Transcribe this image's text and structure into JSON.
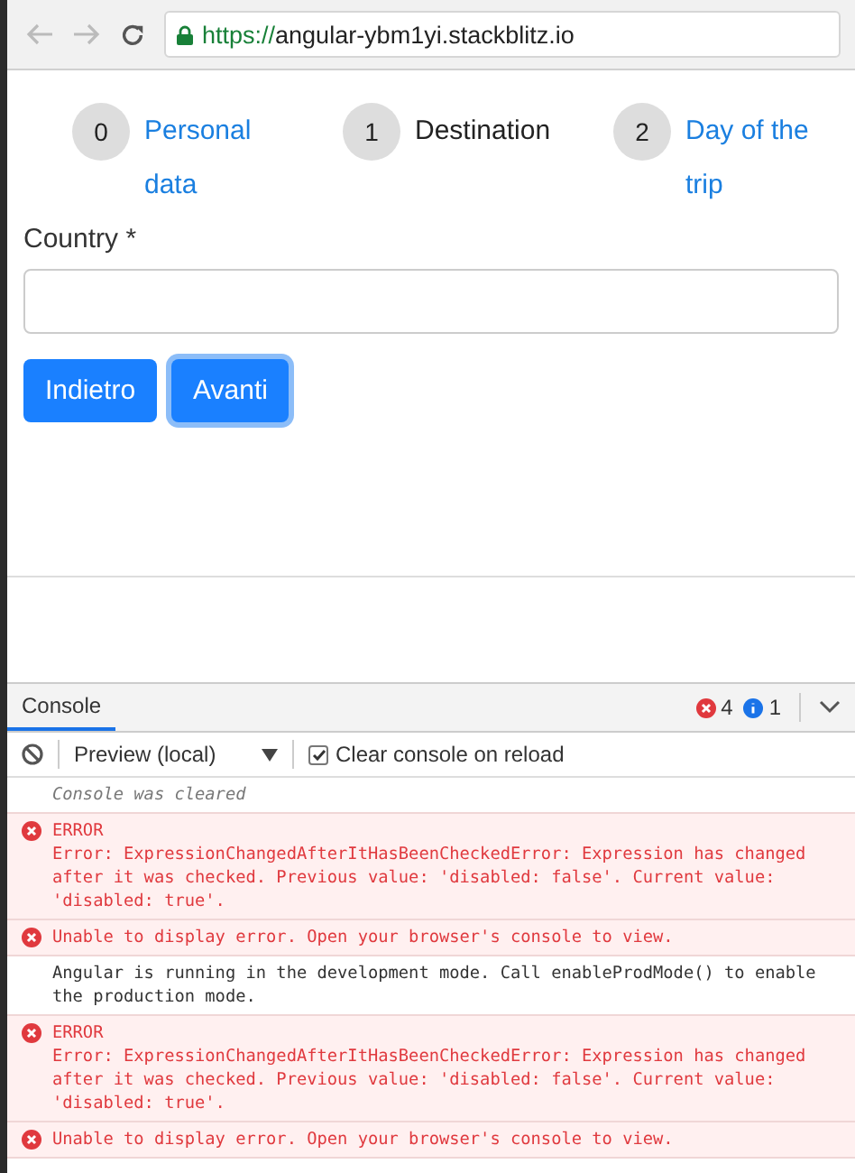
{
  "browser": {
    "url_scheme": "https://",
    "url_host": "angular-ybm1yi.stackblitz.io"
  },
  "steps": [
    {
      "number": "0",
      "label": "Personal data",
      "selected": false
    },
    {
      "number": "1",
      "label": "Destination",
      "selected": true
    },
    {
      "number": "2",
      "label": "Day of the trip",
      "selected": false
    }
  ],
  "form": {
    "label": "Country *"
  },
  "buttons": [
    {
      "label": "Indietro",
      "focused": false
    },
    {
      "label": "Avanti",
      "focused": true
    }
  ],
  "console": {
    "tab": "Console",
    "error_count": "4",
    "info_count": "1",
    "context": "Preview (local)",
    "clear_on_reload": {
      "label": "Clear console on reload",
      "checked": true
    },
    "entries": [
      {
        "kind": "info",
        "text": "Console was cleared"
      },
      {
        "kind": "error",
        "title": "ERROR",
        "text": "Error: ExpressionChangedAfterItHasBeenCheckedError: Expression has changed after it was checked. Previous value: 'disabled: false'. Current value: 'disabled: true'."
      },
      {
        "kind": "error",
        "text": "Unable to display error. Open your browser's console to view."
      },
      {
        "kind": "log",
        "text": "Angular is running in the development mode. Call enableProdMode() to enable the production mode."
      },
      {
        "kind": "error",
        "title": "ERROR",
        "text": "Error: ExpressionChangedAfterItHasBeenCheckedError: Expression has changed after it was checked. Previous value: 'disabled: false'. Current value: 'disabled: true'."
      },
      {
        "kind": "error",
        "text": "Unable to display error. Open your browser's console to view."
      }
    ]
  }
}
